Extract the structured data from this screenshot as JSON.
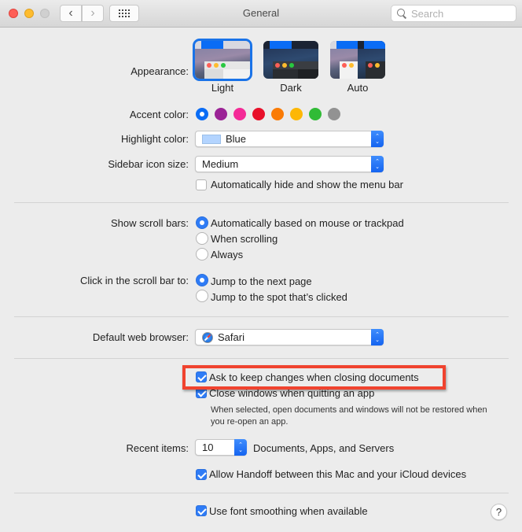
{
  "window": {
    "title": "General",
    "search_placeholder": "Search"
  },
  "appearance": {
    "label": "Appearance:",
    "options": [
      {
        "name": "Light",
        "selected": true
      },
      {
        "name": "Dark",
        "selected": false
      },
      {
        "name": "Auto",
        "selected": false
      }
    ]
  },
  "accent": {
    "label": "Accent color:",
    "colors": [
      {
        "name": "blue",
        "hex": "#0a6cf5",
        "selected": true
      },
      {
        "name": "purple",
        "hex": "#9b2396",
        "selected": false
      },
      {
        "name": "pink",
        "hex": "#f42a97",
        "selected": false
      },
      {
        "name": "red",
        "hex": "#e8102a",
        "selected": false
      },
      {
        "name": "orange",
        "hex": "#fa7b05",
        "selected": false
      },
      {
        "name": "yellow",
        "hex": "#fdb705",
        "selected": false
      },
      {
        "name": "green",
        "hex": "#30bb36",
        "selected": false
      },
      {
        "name": "graphite",
        "hex": "#929292",
        "selected": false
      }
    ]
  },
  "highlight": {
    "label": "Highlight color:",
    "value": "Blue",
    "swatch": "#b3d4ff"
  },
  "sidebar_icon": {
    "label": "Sidebar icon size:",
    "value": "Medium"
  },
  "menu_bar": {
    "label": "Automatically hide and show the menu bar",
    "checked": false
  },
  "scroll_bars": {
    "label": "Show scroll bars:",
    "options": [
      {
        "label": "Automatically based on mouse or trackpad",
        "checked": true
      },
      {
        "label": "When scrolling",
        "checked": false
      },
      {
        "label": "Always",
        "checked": false
      }
    ]
  },
  "scroll_click": {
    "label": "Click in the scroll bar to:",
    "options": [
      {
        "label": "Jump to the next page",
        "checked": true
      },
      {
        "label": "Jump to the spot that’s clicked",
        "checked": false
      }
    ]
  },
  "browser": {
    "label": "Default web browser:",
    "value": "Safari"
  },
  "documents": {
    "ask_keep": {
      "label": "Ask to keep changes when closing documents",
      "checked": true
    },
    "close_windows": {
      "label": "Close windows when quitting an app",
      "checked": true
    },
    "note": "When selected, open documents and windows will not be restored when you re-open an app.",
    "annotation_color": "#f0432f"
  },
  "recent": {
    "label": "Recent items:",
    "value": "10",
    "suffix": "Documents, Apps, and Servers"
  },
  "handoff": {
    "label": "Allow Handoff between this Mac and your iCloud devices",
    "checked": true
  },
  "font_smoothing": {
    "label": "Use font smoothing when available",
    "checked": true
  },
  "help_label": "?"
}
